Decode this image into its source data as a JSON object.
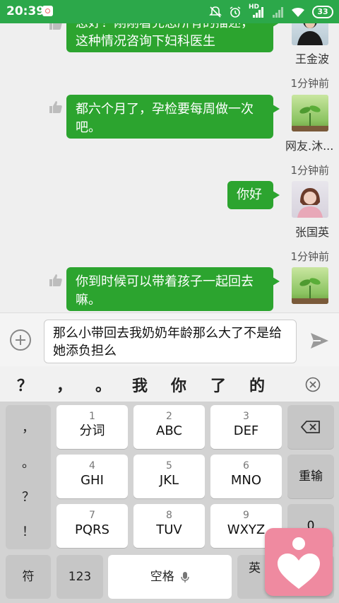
{
  "status_bar": {
    "time": "20:39",
    "battery": "33",
    "hd_label": "HD"
  },
  "chat": {
    "messages": [
      {
        "text": "您好！刚刚看完您所有的描述，这种情况咨询下妇科医生",
        "user": "王金波",
        "time": ""
      },
      {
        "text": "都六个月了，孕检要每周做一次吧。",
        "user": "网友.沐...",
        "time": "1分钟前"
      },
      {
        "text": "你好",
        "user": "张国英",
        "time": "1分钟前"
      },
      {
        "text": "你到时候可以带着孩子一起回去嘛。",
        "user": "",
        "time": "1分钟前"
      }
    ]
  },
  "input": {
    "text": "那么小带回去我奶奶年龄那么大了不是给她添负担么"
  },
  "keyboard": {
    "candidates": [
      "？",
      "，",
      "。",
      "我",
      "你",
      "了",
      "的"
    ],
    "symbols": [
      "，",
      "。",
      "？",
      "！"
    ],
    "keys": [
      {
        "num": "1",
        "label": "分词"
      },
      {
        "num": "2",
        "label": "ABC"
      },
      {
        "num": "3",
        "label": "DEF"
      },
      {
        "num": "4",
        "label": "GHI"
      },
      {
        "num": "5",
        "label": "JKL"
      },
      {
        "num": "6",
        "label": "MNO"
      },
      {
        "num": "7",
        "label": "PQRS"
      },
      {
        "num": "8",
        "label": "TUV"
      },
      {
        "num": "9",
        "label": "WXYZ"
      }
    ],
    "reenter": "重输",
    "zero": "0",
    "symbol_key": "符",
    "num_key": "123",
    "space": "空格",
    "lang": "英"
  },
  "colors": {
    "accent": "#2ca84a",
    "bubble": "#2ca42f",
    "float_app": "#ef8aa0"
  }
}
